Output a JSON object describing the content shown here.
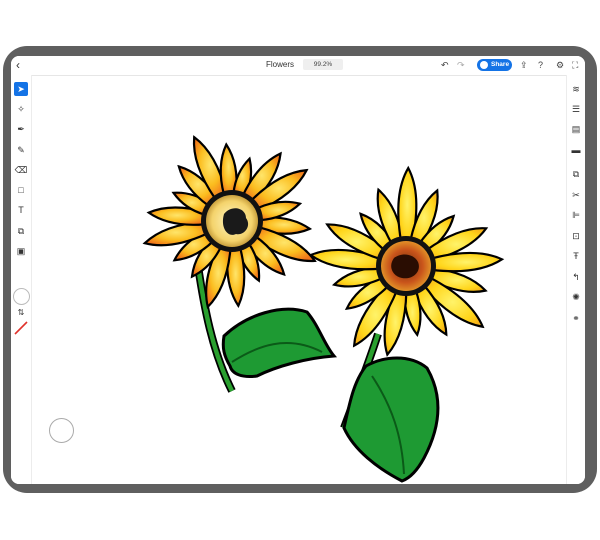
{
  "header": {
    "back_icon": "chevron-left-icon",
    "title": "Flowers",
    "zoom": "99.2%",
    "share_label": "Share",
    "icons": [
      "undo-icon",
      "redo-icon",
      "share-icon",
      "export-icon",
      "help-icon",
      "gear-icon",
      "fit-screen-icon"
    ]
  },
  "left_toolbar": {
    "tools": [
      {
        "name": "selection-tool",
        "glyph": "➤",
        "active": true
      },
      {
        "name": "direct-selection-tool",
        "glyph": "✧",
        "active": false
      },
      {
        "name": "pen-tool",
        "glyph": "✒",
        "active": false
      },
      {
        "name": "pencil-tool",
        "glyph": "✎",
        "active": false
      },
      {
        "name": "eraser-tool",
        "glyph": "⌫",
        "active": false
      },
      {
        "name": "shape-tool",
        "glyph": "□",
        "active": false
      },
      {
        "name": "type-tool",
        "glyph": "T",
        "active": false
      },
      {
        "name": "transform-tool",
        "glyph": "⧉",
        "active": false
      },
      {
        "name": "place-image-tool",
        "glyph": "▣",
        "active": false
      }
    ],
    "fill_color": "#ffffff",
    "stroke_color": "#e0322b",
    "swap_glyph": "⇅"
  },
  "right_toolbar": {
    "tools": [
      "layers-icon",
      "properties-icon",
      "libraries-icon",
      "comments-icon",
      "arrange-icon",
      "scissors-icon",
      "align-icon",
      "crop-icon",
      "type-options-icon",
      "path-icon",
      "repeat-icon",
      "link-icon"
    ]
  },
  "colors": {
    "accent": "#1473e6",
    "frame": "#5f5f5f",
    "petal_orange": "#f7931e",
    "petal_yellow": "#ffd21a",
    "leaf_green": "#1f8f2a"
  }
}
